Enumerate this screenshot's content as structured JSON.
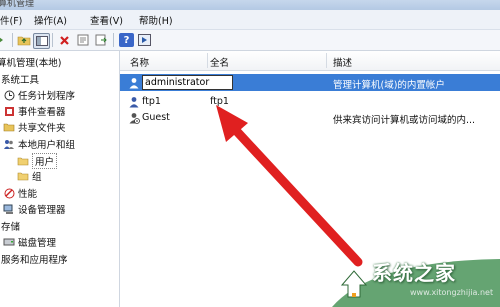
{
  "title_fragment": "算机管理",
  "menu": [
    "件(F)",
    "操作(A)",
    "查看(V)",
    "帮助(H)"
  ],
  "toolbar": [
    "back-icon",
    "forward-icon",
    "up-folder-icon",
    "show-hide-tree-icon",
    "delete-icon",
    "properties-icon",
    "export-list-icon",
    "help-icon",
    "console-tree-icon"
  ],
  "tree": [
    {
      "label": "算机管理(本地)",
      "icon": ""
    },
    {
      "label": "系统工具",
      "icon": ""
    },
    {
      "label": "任务计划程序",
      "icon": "clock-icon"
    },
    {
      "label": "事件查看器",
      "icon": "event-viewer-icon"
    },
    {
      "label": "共享文件夹",
      "icon": "shared-folder-icon"
    },
    {
      "label": "本地用户和组",
      "icon": "users-group-icon"
    },
    {
      "label": "用户",
      "icon": "folder-icon"
    },
    {
      "label": "组",
      "icon": "folder-icon"
    },
    {
      "label": "性能",
      "icon": "performance-icon"
    },
    {
      "label": "设备管理器",
      "icon": "device-manager-icon"
    },
    {
      "label": "存储",
      "icon": ""
    },
    {
      "label": "磁盘管理",
      "icon": "disk-management-icon"
    },
    {
      "label": "服务和应用程序",
      "icon": ""
    }
  ],
  "columns": [
    "名称",
    "全名",
    "描述"
  ],
  "rows": [
    {
      "name": "administrator",
      "fullname": "",
      "description": "管理计算机(域)的内置帐户",
      "editing": true
    },
    {
      "name": "ftp1",
      "fullname": "ftp1",
      "description": ""
    },
    {
      "name": "Guest",
      "fullname": "",
      "description": "供来宾访问计算机或访问域的内..."
    }
  ],
  "watermark": {
    "text": "系统之家",
    "url": "www.xitongzhijia.net"
  },
  "colors": {
    "selection": "#3a7dd6",
    "arrow": "#e02020",
    "watermark_green": "#3a8a4a"
  }
}
